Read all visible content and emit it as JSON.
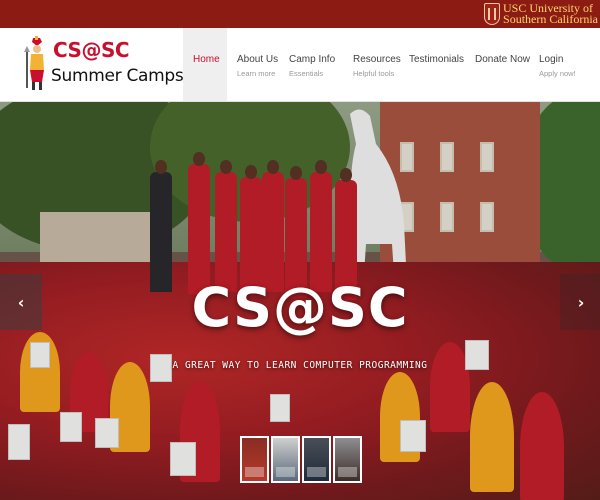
{
  "usc": {
    "line1": "USC University of",
    "line2": "Southern California"
  },
  "logo": {
    "cs": "CS@SC",
    "sub": "Summer Camps"
  },
  "nav": [
    {
      "label": "Home",
      "sub": ""
    },
    {
      "label": "About Us",
      "sub": "Learn more"
    },
    {
      "label": "Camp Info",
      "sub": "Essentials"
    },
    {
      "label": "Resources",
      "sub": "Helpful tools"
    },
    {
      "label": "Testimonials",
      "sub": ""
    },
    {
      "label": "Donate Now",
      "sub": ""
    },
    {
      "label": "Login",
      "sub": "Apply now!"
    }
  ],
  "hero": {
    "title": "CS@SC",
    "tagline": "A GREAT WAY TO LEARN COMPUTER PROGRAMMING",
    "prev_icon": "‹",
    "next_icon": "›"
  },
  "colors": {
    "usc_bar": "#8c1c13",
    "accent": "#c8102e"
  }
}
